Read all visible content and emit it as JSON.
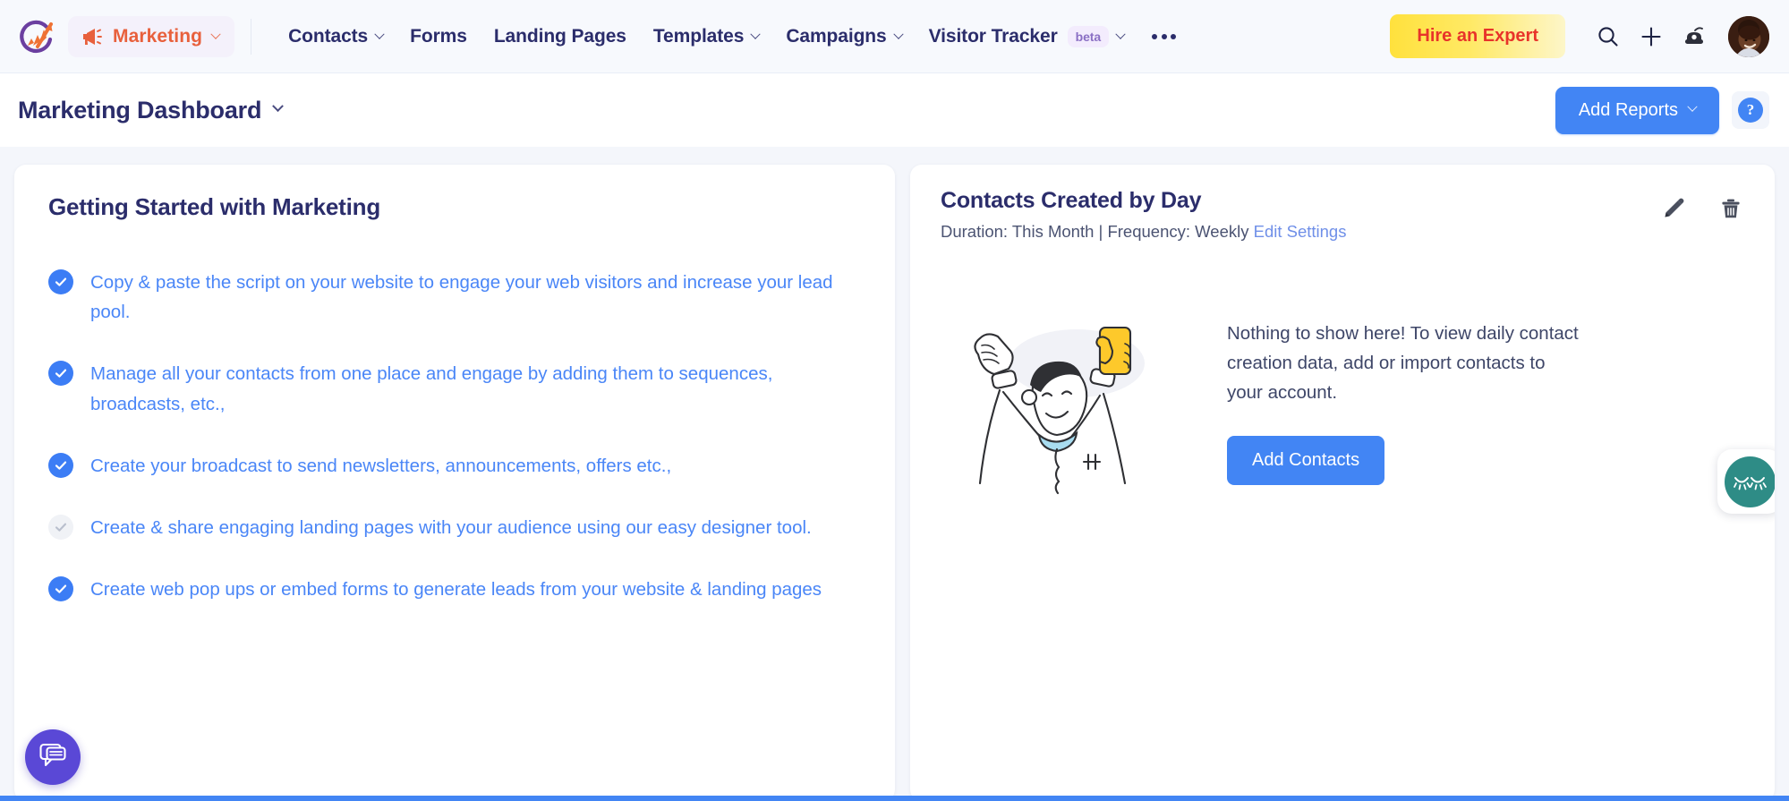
{
  "topnav": {
    "logo_icon": "zoho-marketing-logo-icon",
    "brand": {
      "label": "Marketing",
      "icon": "megaphone-icon",
      "caret": "chevron-down-icon"
    },
    "items": [
      {
        "label": "Contacts",
        "has_caret": true
      },
      {
        "label": "Forms",
        "has_caret": false
      },
      {
        "label": "Landing Pages",
        "has_caret": false
      },
      {
        "label": "Templates",
        "has_caret": true
      },
      {
        "label": "Campaigns",
        "has_caret": true
      },
      {
        "label": "Visitor Tracker",
        "badge": "beta",
        "has_caret": true
      }
    ],
    "overflow_label": "more-menu",
    "hire_button": "Hire an Expert",
    "search_icon": "search-icon",
    "add_icon": "plus-icon",
    "support_icon": "telephone-icon",
    "avatar": "user-avatar"
  },
  "subheader": {
    "title": "Marketing Dashboard",
    "caret": "chevron-down-icon",
    "add_reports": "Add Reports",
    "help": "?"
  },
  "getting_started": {
    "title": "Getting Started with Marketing",
    "items": [
      {
        "text": "Copy & paste the script on your website to engage your web visitors and increase your lead pool.",
        "done": true
      },
      {
        "text": "Manage all your contacts from one place and engage by adding them to sequences, broadcasts, etc.,",
        "done": true
      },
      {
        "text": "Create your broadcast to send newsletters, announcements, offers etc.,",
        "done": true
      },
      {
        "text": "Create & share engaging landing pages with your audience using our easy designer tool.",
        "done": false
      },
      {
        "text": "Create web pop ups or embed forms to generate leads from your website & landing pages",
        "done": true
      }
    ]
  },
  "report_card": {
    "title": "Contacts Created by Day",
    "meta_prefix": "Duration: This Month | Frequency: Weekly",
    "edit_settings": "Edit Settings",
    "edit_icon": "pencil-icon",
    "delete_icon": "trash-icon",
    "empty_illustration": "celebrating-person-with-phone-illustration",
    "empty_text": "Nothing to show here! To view daily contact creation data, add or import contacts to your account.",
    "empty_button": "Add Contacts"
  },
  "floating": {
    "eye_widget": "closed-eyes-icon",
    "chat_widget": "chat-bubble-icon"
  },
  "colors": {
    "brand_orange": "#e8603c",
    "nav_text": "#2b2d6b",
    "accent_blue": "#4285f4",
    "link_blue": "#4a86f7",
    "hire_yellow": "#ffe13d",
    "hire_text": "#e8342a",
    "teal": "#2e8c86",
    "purple": "#5a48d6",
    "beta_badge_bg": "#f3ecfd",
    "page_bg": "#f4f6fb"
  }
}
